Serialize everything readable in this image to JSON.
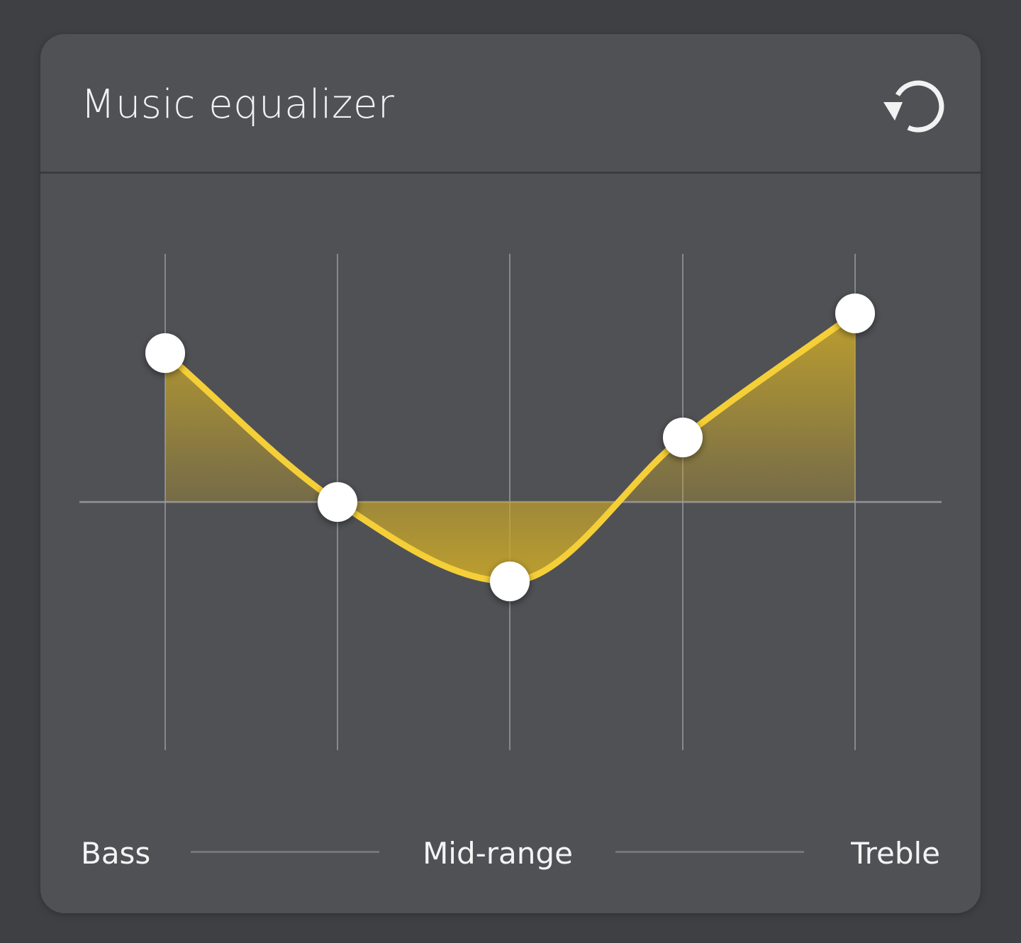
{
  "header": {
    "title": "Music equalizer",
    "reset_icon": "reset-icon"
  },
  "colors": {
    "accent": "#f5cf37",
    "card_bg": "#505155",
    "page_bg": "#3f4043",
    "handle": "#ffffff",
    "grid": "#9a9ba0"
  },
  "bands": {
    "low_label": "Bass",
    "mid_label": "Mid-range",
    "high_label": "Treble"
  },
  "chart_data": {
    "type": "line",
    "bands": 5,
    "range": [
      -1,
      1
    ],
    "values": [
      0.6,
      0.0,
      -0.32,
      0.26,
      0.76
    ]
  }
}
